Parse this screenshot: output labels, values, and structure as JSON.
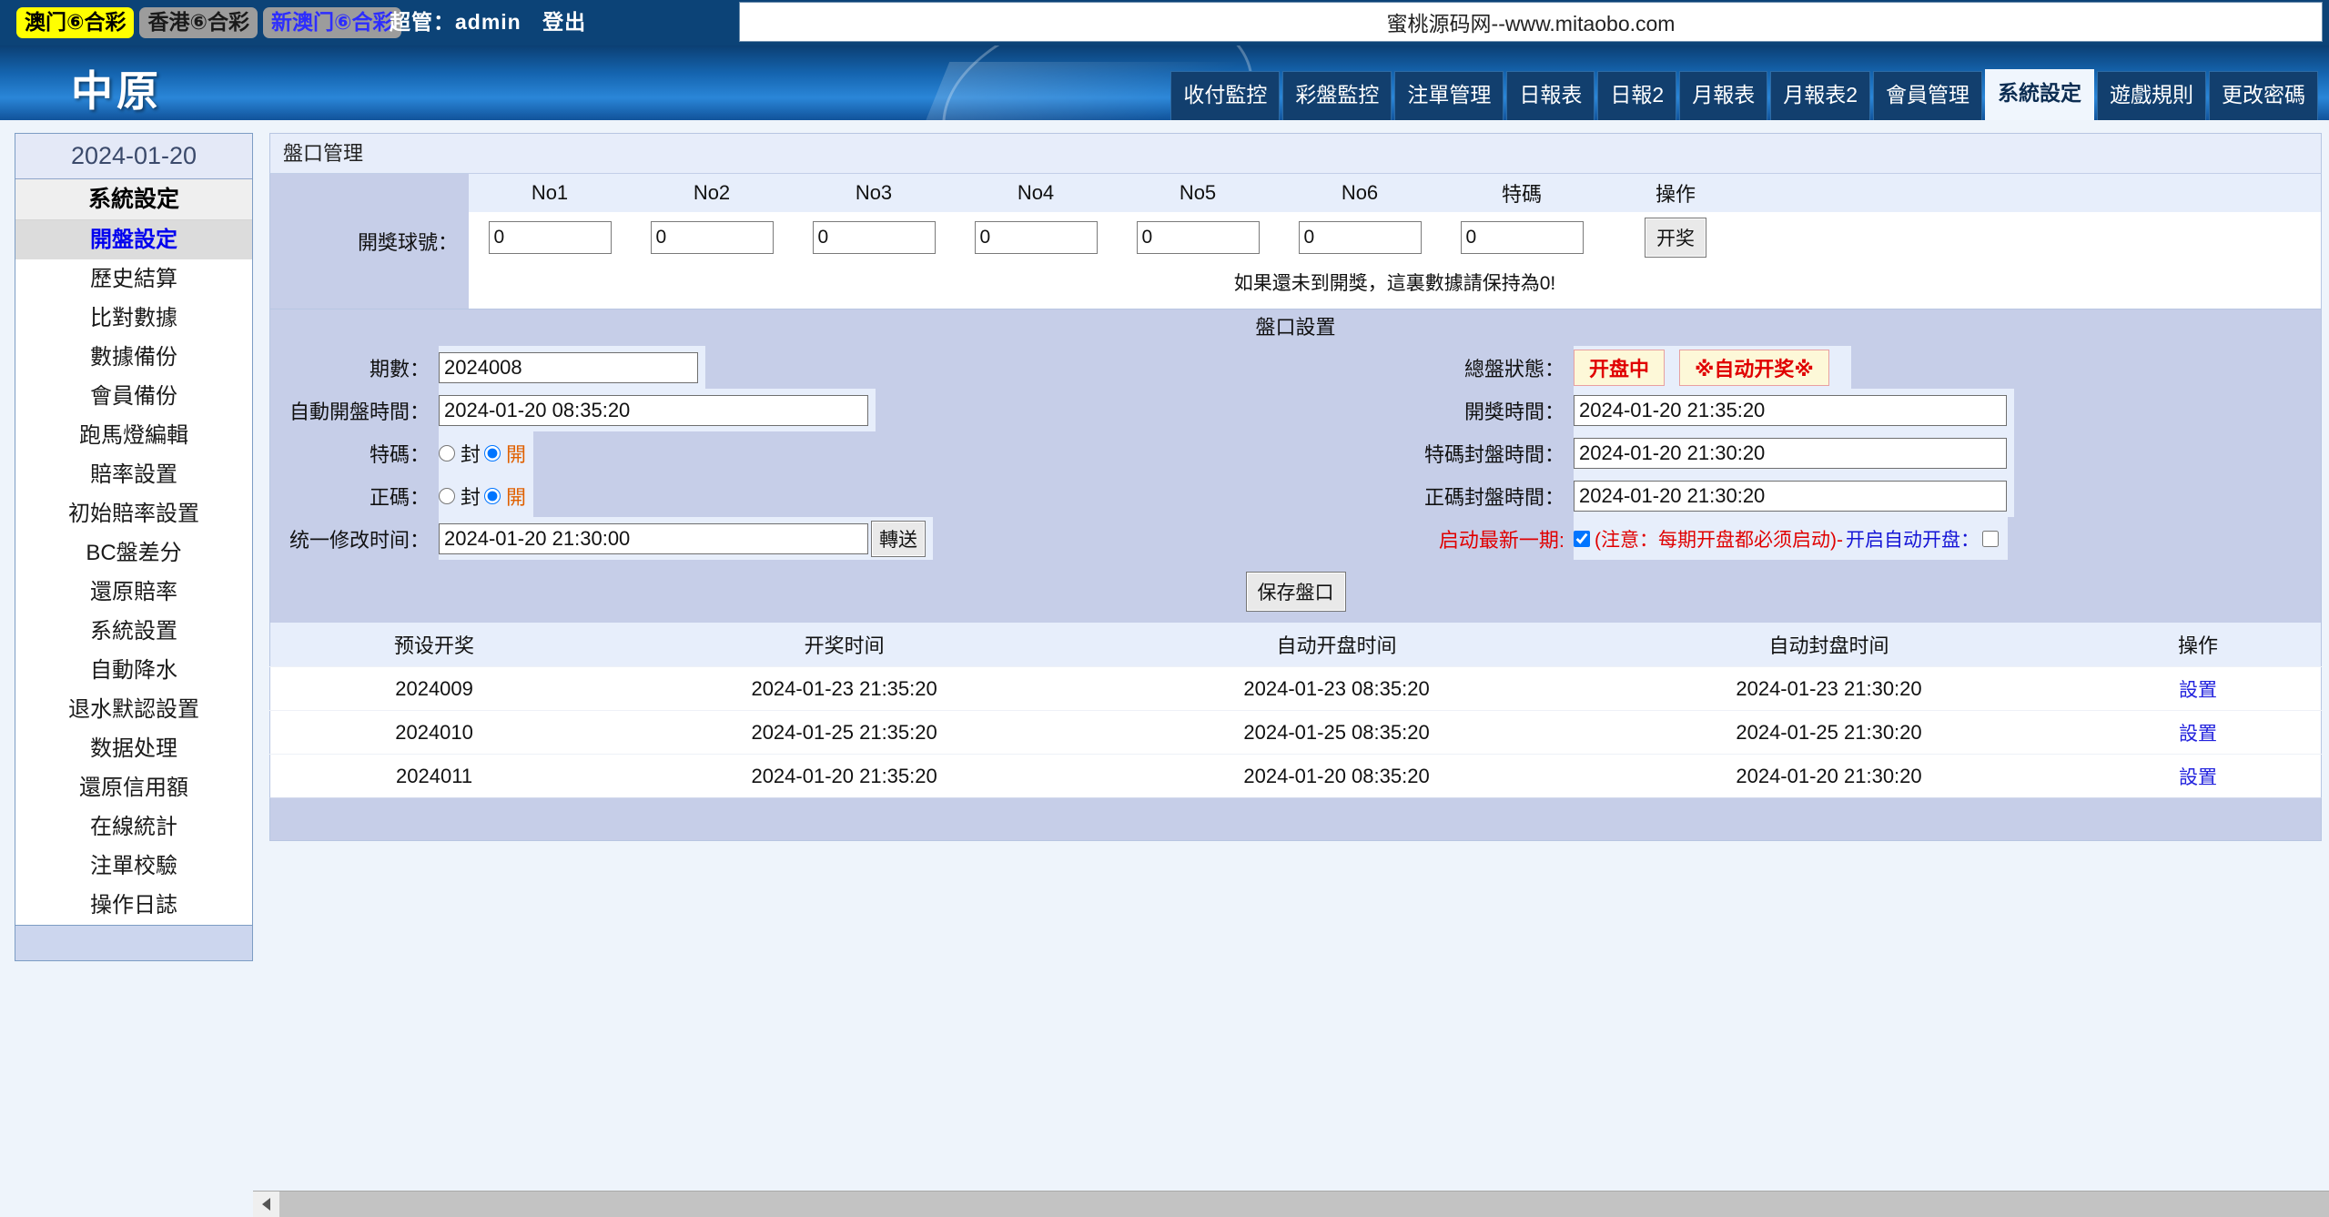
{
  "topbar": {
    "game_tabs": [
      {
        "label": "澳门⑥合彩",
        "state": "active"
      },
      {
        "label": "香港⑥合彩",
        "state": "grey"
      },
      {
        "label": "新澳门⑥合彩",
        "state": "blue"
      }
    ],
    "admin_prefix": "超管：admin",
    "logout_label": "登出",
    "url_text": "蜜桃源码网--www.mitaobo.com"
  },
  "banner": {
    "logo": "中原",
    "nav_tabs": [
      {
        "label": "收付監控",
        "active": false
      },
      {
        "label": "彩盤監控",
        "active": false
      },
      {
        "label": "注單管理",
        "active": false
      },
      {
        "label": "日報表",
        "active": false
      },
      {
        "label": "日報2",
        "active": false
      },
      {
        "label": "月報表",
        "active": false
      },
      {
        "label": "月報表2",
        "active": false
      },
      {
        "label": "會員管理",
        "active": false
      },
      {
        "label": "系統設定",
        "active": true
      },
      {
        "label": "遊戲規則",
        "active": false
      },
      {
        "label": "更改密碼",
        "active": false
      }
    ]
  },
  "sidebar": {
    "date": "2024-01-20",
    "title": "系統設定",
    "items": [
      {
        "label": "開盤設定",
        "selected": true
      },
      {
        "label": "歷史結算",
        "selected": false
      },
      {
        "label": "比對數據",
        "selected": false
      },
      {
        "label": "數據備份",
        "selected": false
      },
      {
        "label": "會員備份",
        "selected": false
      },
      {
        "label": "跑馬燈編輯",
        "selected": false
      },
      {
        "label": "賠率設置",
        "selected": false
      },
      {
        "label": "初始賠率設置",
        "selected": false
      },
      {
        "label": "BC盤差分",
        "selected": false
      },
      {
        "label": "還原賠率",
        "selected": false
      },
      {
        "label": "系統設置",
        "selected": false
      },
      {
        "label": "自動降水",
        "selected": false
      },
      {
        "label": "退水默認設置",
        "selected": false
      },
      {
        "label": "数据处理",
        "selected": false
      },
      {
        "label": "還原信用額",
        "selected": false
      },
      {
        "label": "在線統計",
        "selected": false
      },
      {
        "label": "注單校驗",
        "selected": false
      },
      {
        "label": "操作日誌",
        "selected": false
      }
    ]
  },
  "panel": {
    "title": "盤口管理",
    "draw": {
      "row_label": "開獎球號：",
      "headers": [
        "No1",
        "No2",
        "No3",
        "No4",
        "No5",
        "No6",
        "特碼",
        "操作"
      ],
      "values": [
        "0",
        "0",
        "0",
        "0",
        "0",
        "0",
        "0"
      ],
      "action_label": "开奖",
      "hint": "如果還未到開獎，這裏數據請保持為0!"
    },
    "settings": {
      "section_title": "盤口設置",
      "period_label": "期數：",
      "period_value": "2024008",
      "auto_open_label": "自動開盤時間：",
      "auto_open_value": "2024-01-20 08:35:20",
      "special_label": "特碼：",
      "normal_label": "正碼：",
      "radio_closed": "封",
      "radio_open": "開",
      "special_state": "開",
      "normal_state": "開",
      "unified_label": "统一修改时间：",
      "unified_value": "2024-01-20 21:30:00",
      "transfer_label": "轉送",
      "status_label": "總盤狀態：",
      "status_badge_1": "开盘中",
      "status_badge_2": "※自动开奖※",
      "draw_time_label": "開獎時間：",
      "draw_time_value": "2024-01-20 21:35:20",
      "special_close_label": "特碼封盤時間：",
      "special_close_value": "2024-01-20 21:30:20",
      "normal_close_label": "正碼封盤時間：",
      "normal_close_value": "2024-01-20 21:30:20",
      "start_latest_label": "启动最新一期:",
      "start_latest_checked": true,
      "start_note": "(注意：每期开盘都必须启动)-",
      "auto_open_toggle_label": "开启自动开盘：",
      "auto_open_toggle_checked": false,
      "save_label": "保存盤口"
    },
    "table": {
      "headers": [
        "预设开奖",
        "开奖时间",
        "自动开盘时间",
        "自动封盘时间",
        "操作"
      ],
      "rows": [
        {
          "period": "2024009",
          "draw_time": "2024-01-23 21:35:20",
          "auto_open": "2024-01-23 08:35:20",
          "auto_close": "2024-01-23 21:30:20",
          "action": "設置"
        },
        {
          "period": "2024010",
          "draw_time": "2024-01-25 21:35:20",
          "auto_open": "2024-01-25 08:35:20",
          "auto_close": "2024-01-25 21:30:20",
          "action": "設置"
        },
        {
          "period": "2024011",
          "draw_time": "2024-01-20 21:35:20",
          "auto_open": "2024-01-20 08:35:20",
          "auto_close": "2024-01-20 21:30:20",
          "action": "設置"
        }
      ]
    }
  },
  "colors": {
    "brand_blue": "#0c4377",
    "accent_red": "#e00000",
    "link_blue": "#2222dd",
    "active_tab_bg": "#f0f6fd",
    "highlight_yellow": "#ffff00"
  }
}
